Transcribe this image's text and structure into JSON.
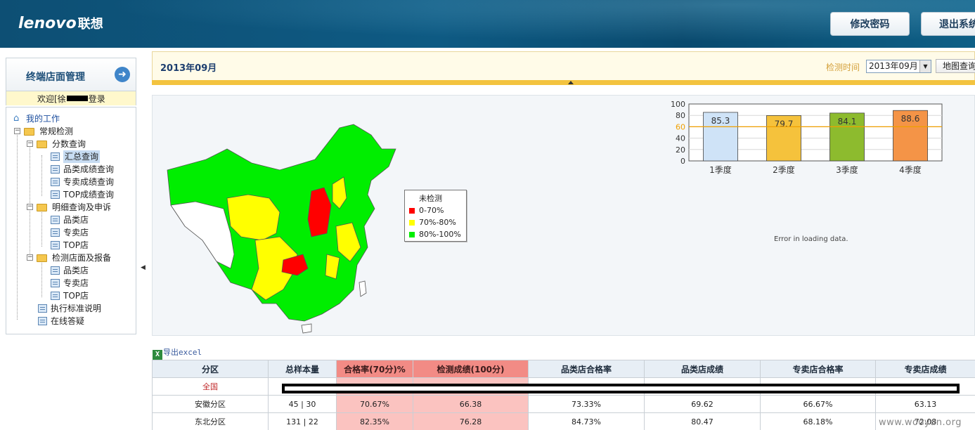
{
  "header": {
    "logo_text": "lenovo",
    "logo_cn": "联想",
    "change_password_label": "修改密码",
    "logout_label": "退出系统"
  },
  "sidebar": {
    "title": "终端店面管理",
    "welcome_prefix": "欢迎[徐",
    "welcome_suffix": "登录",
    "tree": {
      "root": "我的工作",
      "regular": "常规检测",
      "score_query": "分数查询",
      "summary_query": "汇总查询",
      "category_score_query": "品类成绩查询",
      "exclusive_score_query": "专卖成绩查询",
      "top_score_query": "TOP成绩查询",
      "detail_query": "明细查询及申诉",
      "detail_category": "品类店",
      "detail_exclusive": "专卖店",
      "detail_top": "TOP店",
      "inspect_report": "检测店面及报备",
      "report_category": "品类店",
      "report_exclusive": "专卖店",
      "report_top": "TOP店",
      "standards": "执行标准说明",
      "online_qa": "在线答疑"
    }
  },
  "topbar": {
    "title": "2013年09月",
    "time_label": "检测时间",
    "selected_month": "2013年09月",
    "map_query_label": "地图查询"
  },
  "map": {
    "legend": [
      {
        "label": "未检测",
        "color": "#ffffff"
      },
      {
        "label": "0-70%",
        "color": "#ff0000"
      },
      {
        "label": "70%-80%",
        "color": "#ffff00"
      },
      {
        "label": "80%-100%",
        "color": "#00ff00"
      }
    ],
    "error_text": "Error in loading data."
  },
  "chart_data": {
    "type": "bar",
    "categories": [
      "1季度",
      "2季度",
      "3季度",
      "4季度"
    ],
    "values": [
      85.3,
      79.7,
      84.1,
      88.6
    ],
    "bar_colors": [
      "#cfe3f7",
      "#f5c23c",
      "#8dbb2e",
      "#f49447"
    ],
    "ylim": [
      0,
      100
    ],
    "yticks": [
      0,
      20,
      40,
      60,
      80,
      100
    ],
    "reference_line": 60,
    "reference_color": "#f0a000",
    "grid": true
  },
  "table": {
    "export_label": "导出excel",
    "columns": [
      "分区",
      "总样本量",
      "合格率(70分)%",
      "检测成绩(100分)",
      "品类店合格率",
      "品类店成绩",
      "专卖店合格率",
      "专卖店成绩"
    ],
    "rows": [
      {
        "region": "全国",
        "samples": "",
        "pass_rate": "",
        "score": "",
        "cat_pass": "",
        "cat_score": "",
        "exc_pass": "",
        "exc_score": ""
      },
      {
        "region": "安徽分区",
        "samples": "45 | 30",
        "pass_rate": "70.67%",
        "score": "66.38",
        "cat_pass": "73.33%",
        "cat_score": "69.62",
        "exc_pass": "66.67%",
        "exc_score": "63.13"
      },
      {
        "region": "东北分区",
        "samples": "131 | 22",
        "pass_rate": "82.35%",
        "score": "76.28",
        "cat_pass": "84.73%",
        "cat_score": "80.47",
        "exc_pass": "68.18%",
        "exc_score": "72.08"
      }
    ]
  },
  "watermark": "www.wooyun.org"
}
